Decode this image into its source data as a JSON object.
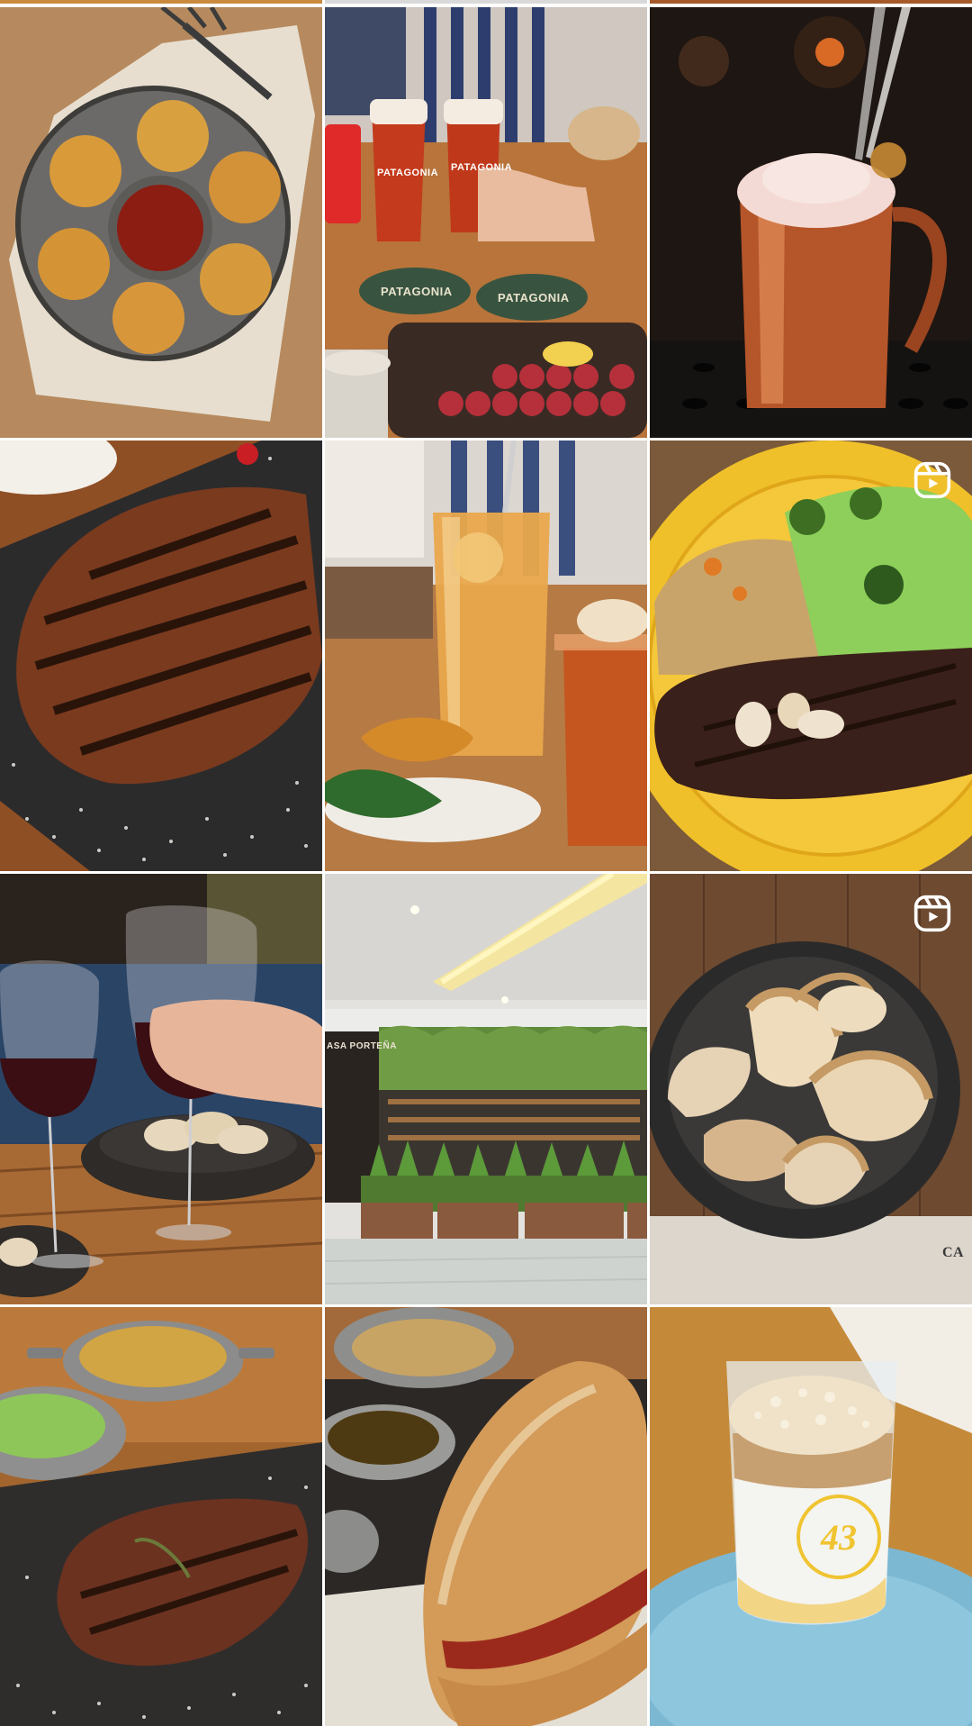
{
  "grid": {
    "tiles": [
      {
        "subject": "Breaded croquettes around a bowl of red sauce on paper",
        "is_reel": false
      },
      {
        "subject": "Toasting Patagonia beers over sausage board",
        "is_reel": false,
        "texts": [
          "PATAGONIA",
          "PATAGONIA",
          "PATAGONIA",
          "PATAGONIA"
        ]
      },
      {
        "subject": "Copper mug cocktail with foam",
        "is_reel": false
      },
      {
        "subject": "Grilled steak on salted slate",
        "is_reel": false
      },
      {
        "subject": "Iced cocktails on wooden table",
        "is_reel": false
      },
      {
        "subject": "Steak with farofa and broccoli rice on yellow plate",
        "is_reel": true
      },
      {
        "subject": "Red wine glasses toast with empanadas",
        "is_reel": false
      },
      {
        "subject": "Restaurant storefront with plant wall",
        "is_reel": false,
        "texts": [
          "ASA PORTEÑA"
        ]
      },
      {
        "subject": "Empanadas in stone bowl",
        "is_reel": true,
        "texts": [
          "CA"
        ]
      },
      {
        "subject": "Steak with side pots on salted tray",
        "is_reel": false
      },
      {
        "subject": "Choripán sandwich with soups and sauces",
        "is_reel": false
      },
      {
        "subject": "Dessert in glass cup on blue plate",
        "is_reel": false,
        "texts": [
          "43"
        ]
      }
    ]
  },
  "icons": {
    "reel": "reels-icon"
  },
  "colors": {
    "background": "#ffffff",
    "badge": "#ffffff"
  }
}
